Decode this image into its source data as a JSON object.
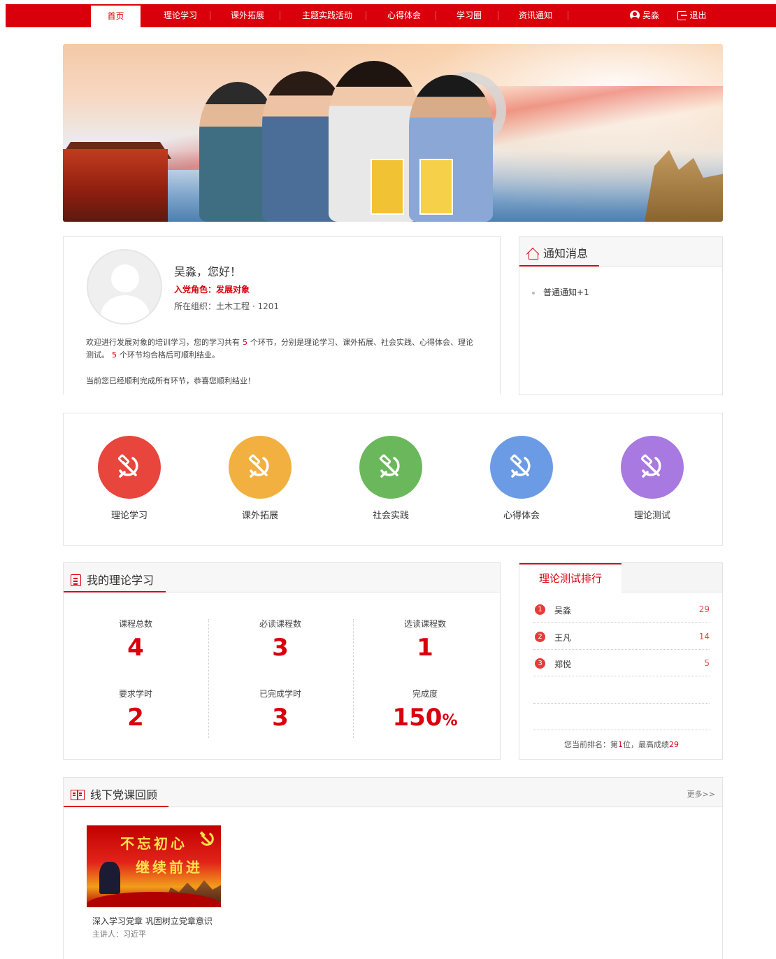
{
  "nav": {
    "items": [
      "首页",
      "理论学习",
      "课外拓展",
      "主题实践活动",
      "心得体会",
      "学习圈",
      "资讯通知"
    ],
    "user": "吴淼",
    "logout": "退出"
  },
  "profile": {
    "greeting": "吴淼，您好！",
    "role": "入党角色：发展对象",
    "org": "所在组织：土木工程 · 1201",
    "intro_1": "欢迎进行发展对象的培训学习，您的学习共有",
    "intro_num_1": "5",
    "intro_2": "个环节，分别是理论学习、课外拓展、社会实践、心得体会、理论测试。",
    "intro_num_2": "5",
    "intro_3": "个环节均合格后可顺利结业。",
    "done": "当前您已经顺利完成所有环节，恭喜您顺利结业！"
  },
  "notice": {
    "title": "通知消息",
    "items": [
      "普通通知+1"
    ]
  },
  "modules": [
    {
      "label": "理论学习",
      "color": "#e8453c",
      "icon": "hammer-sickle-icon"
    },
    {
      "label": "课外拓展",
      "color": "#f1b040",
      "icon": "hammer-sickle-icon"
    },
    {
      "label": "社会实践",
      "color": "#6ab85b",
      "icon": "hammer-sickle-icon"
    },
    {
      "label": "心得体会",
      "color": "#6b9be4",
      "icon": "hammer-sickle-icon"
    },
    {
      "label": "理论测试",
      "color": "#a879e0",
      "icon": "hammer-sickle-icon"
    }
  ],
  "study": {
    "title": "我的理论学习",
    "stats": [
      {
        "label": "课程总数",
        "value": "4"
      },
      {
        "label": "必读课程数",
        "value": "3"
      },
      {
        "label": "选读课程数",
        "value": "1"
      },
      {
        "label": "要求学时",
        "value": "2"
      },
      {
        "label": "已完成学时",
        "value": "3"
      },
      {
        "label": "完成度",
        "value": "150",
        "unit": "%"
      }
    ]
  },
  "rank": {
    "title": "理论测试排行",
    "rows": [
      {
        "num": "1",
        "name": "吴淼",
        "score": "29"
      },
      {
        "num": "2",
        "name": "王凡",
        "score": "14"
      },
      {
        "num": "3",
        "name": "郑悦",
        "score": "5"
      }
    ],
    "foot_prefix": "您当前排名：第",
    "foot_rank": "1",
    "foot_mid": "位，最高成绩",
    "foot_score": "29"
  },
  "offline": {
    "title": "线下党课回顾",
    "more": "更多>>",
    "course": {
      "img_text_1": "不忘初心",
      "img_text_2": "继续前进",
      "title": "深入学习党章 巩固树立党章意识",
      "speaker": "主讲人：习近平"
    }
  },
  "colors": {
    "brand_red": "#d9000c"
  }
}
